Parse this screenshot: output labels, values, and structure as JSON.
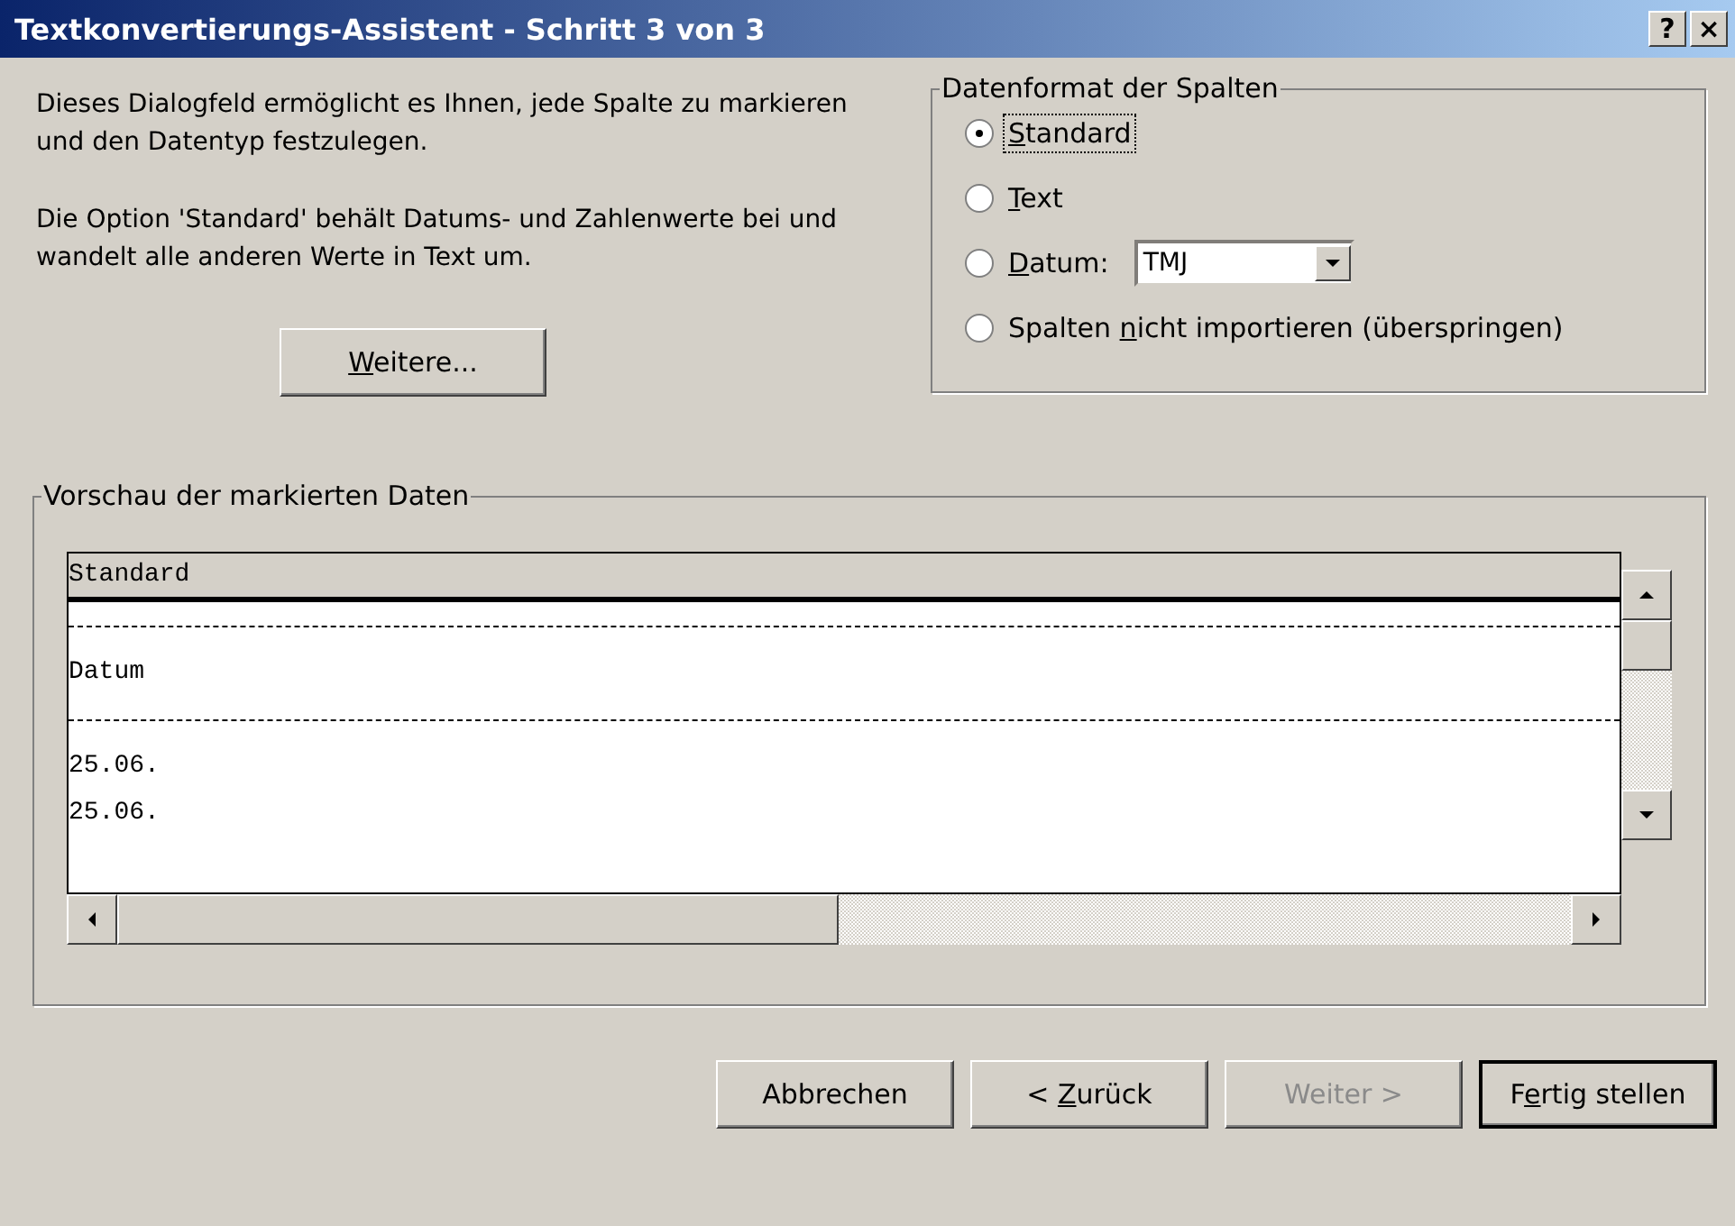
{
  "window": {
    "title": "Textkonvertierungs-Assistent - Schritt 3 von 3",
    "title_buttons": [
      "?",
      "×"
    ]
  },
  "description": [
    "Dieses Dialogfeld ermöglicht es Ihnen, jede Spalte zu markieren und den Datentyp festzulegen.",
    "Die Option 'Standard' behält Datums- und Zahlenwerte bei und wandelt alle anderen Werte in Text um."
  ],
  "more_button": {
    "accesskey": "W",
    "after": "eitere..."
  },
  "format_group": {
    "title": "Datenformat der Spalten",
    "options": [
      {
        "kind": "plain",
        "accesskey": "S",
        "after": "tandard",
        "selected": true,
        "focused": true
      },
      {
        "kind": "plain",
        "accesskey": "T",
        "after": "ext",
        "selected": false,
        "focused": false
      },
      {
        "kind": "date",
        "accesskey": "D",
        "after": "atum:",
        "selected": false,
        "focused": false,
        "dropdown_value": "TMJ"
      },
      {
        "kind": "plain",
        "before": "Spalten ",
        "accesskey": "n",
        "after": "icht importieren (überspringen)",
        "selected": false,
        "focused": false
      }
    ]
  },
  "preview": {
    "title": "Vorschau der markierten Daten",
    "header": "Standard",
    "lines": [
      {
        "kind": "separator"
      },
      {
        "kind": "text",
        "text": "Datum"
      },
      {
        "kind": "separator"
      },
      {
        "kind": "text",
        "text": "25.06."
      },
      {
        "kind": "text",
        "text": "25.06."
      }
    ]
  },
  "buttons": [
    {
      "before": "Abbrechen",
      "disabled": false,
      "default": false
    },
    {
      "before": "< ",
      "accesskey": "Z",
      "after": "urück",
      "disabled": false,
      "default": false
    },
    {
      "before": "Weiter >",
      "disabled": true,
      "default": false
    },
    {
      "before": "F",
      "accesskey": "e",
      "after": "rtig stellen",
      "disabled": false,
      "default": true
    }
  ]
}
